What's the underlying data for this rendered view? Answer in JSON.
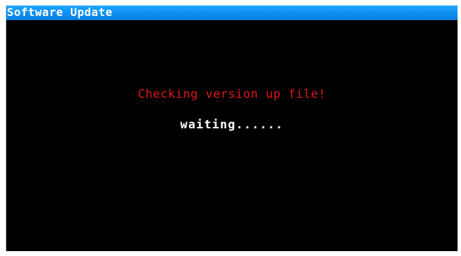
{
  "window": {
    "title": "Software Update"
  },
  "main": {
    "message": "Checking version up file!",
    "status": "waiting......"
  },
  "colors": {
    "title_bar": "#0e8ff0",
    "background": "#000000",
    "message": "#e01818",
    "status": "#ffffff"
  }
}
